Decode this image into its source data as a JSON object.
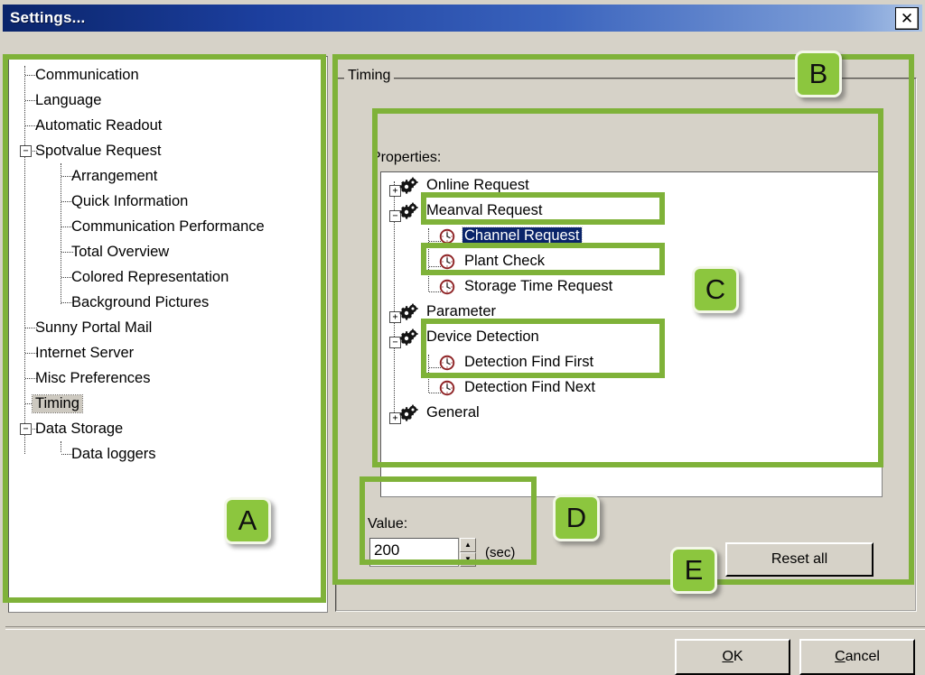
{
  "window": {
    "title": "Settings...",
    "close_label": "✕"
  },
  "left_tree": {
    "items": [
      {
        "label": "Communication",
        "level": 0,
        "toggle": "",
        "selected": false
      },
      {
        "label": "Language",
        "level": 0,
        "toggle": "",
        "selected": false
      },
      {
        "label": "Automatic Readout",
        "level": 0,
        "toggle": "",
        "selected": false
      },
      {
        "label": "Spotvalue Request",
        "level": 0,
        "toggle": "−",
        "selected": false
      },
      {
        "label": "Arrangement",
        "level": 1,
        "toggle": "",
        "selected": false
      },
      {
        "label": "Quick Information",
        "level": 1,
        "toggle": "",
        "selected": false
      },
      {
        "label": "Communication Performance",
        "level": 1,
        "toggle": "",
        "selected": false
      },
      {
        "label": "Total Overview",
        "level": 1,
        "toggle": "",
        "selected": false
      },
      {
        "label": "Colored Representation",
        "level": 1,
        "toggle": "",
        "selected": false
      },
      {
        "label": "Background Pictures",
        "level": 1,
        "toggle": "",
        "selected": false
      },
      {
        "label": "Sunny Portal Mail",
        "level": 0,
        "toggle": "",
        "selected": false
      },
      {
        "label": "Internet Server",
        "level": 0,
        "toggle": "",
        "selected": false
      },
      {
        "label": "Misc Preferences",
        "level": 0,
        "toggle": "",
        "selected": false
      },
      {
        "label": "Timing",
        "level": 0,
        "toggle": "",
        "selected": true
      },
      {
        "label": "Data Storage",
        "level": 0,
        "toggle": "−",
        "selected": false
      },
      {
        "label": "Data loggers",
        "level": 1,
        "toggle": "",
        "selected": false
      }
    ]
  },
  "timing_group": {
    "legend": "Timing",
    "properties_label": "Properties:",
    "properties": [
      {
        "label": "Online Request",
        "level": 0,
        "toggle": "+",
        "icon": "gear-icon",
        "selected": false
      },
      {
        "label": "Meanval Request",
        "level": 0,
        "toggle": "−",
        "icon": "gear-icon",
        "selected": false
      },
      {
        "label": "Channel Request",
        "level": 1,
        "toggle": "",
        "icon": "clock-icon",
        "selected": true
      },
      {
        "label": "Plant Check",
        "level": 1,
        "toggle": "",
        "icon": "clock-icon",
        "selected": false
      },
      {
        "label": "Storage Time Request",
        "level": 1,
        "toggle": "",
        "icon": "clock-icon",
        "selected": false
      },
      {
        "label": "Parameter",
        "level": 0,
        "toggle": "+",
        "icon": "gear-icon",
        "selected": false
      },
      {
        "label": "Device Detection",
        "level": 0,
        "toggle": "−",
        "icon": "gear-icon",
        "selected": false
      },
      {
        "label": "Detection Find First",
        "level": 1,
        "toggle": "",
        "icon": "clock-icon",
        "selected": false
      },
      {
        "label": "Detection Find Next",
        "level": 1,
        "toggle": "",
        "icon": "clock-icon",
        "selected": false
      },
      {
        "label": "General",
        "level": 0,
        "toggle": "+",
        "icon": "gear-icon",
        "selected": false
      }
    ],
    "value_label": "Value:",
    "value": "200",
    "value_units": "(sec)",
    "spinner_up": "▲",
    "spinner_down": "▼",
    "reset_all_label": "Reset all"
  },
  "buttons": {
    "ok_accel": "O",
    "ok_rest": "K",
    "cancel_accel": "C",
    "cancel_rest": "ancel"
  },
  "annotations": {
    "colors": {
      "highlight_green": "#7fb239",
      "marker_green": "#8cc63e",
      "selection_blue": "#0a246a",
      "titlebar_blue": "#0a246a"
    },
    "markers": [
      {
        "letter": "A"
      },
      {
        "letter": "B"
      },
      {
        "letter": "C"
      },
      {
        "letter": "D"
      },
      {
        "letter": "E"
      }
    ]
  }
}
